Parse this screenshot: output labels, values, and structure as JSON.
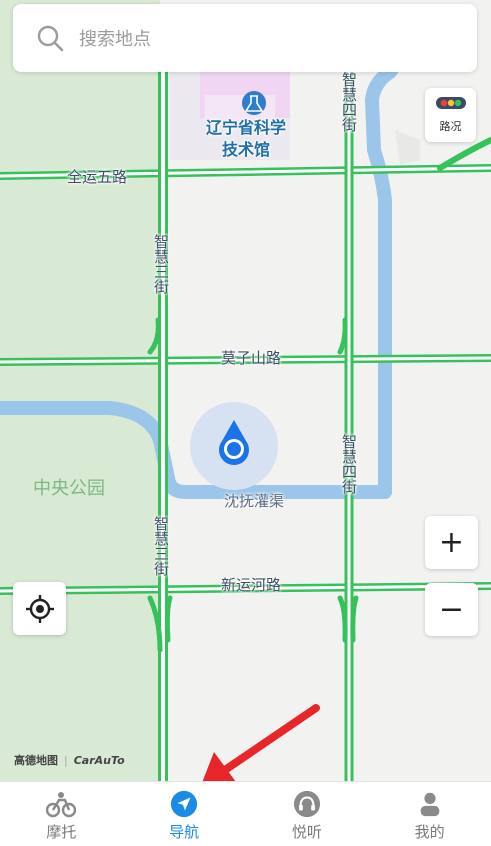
{
  "search": {
    "placeholder": "搜索地点"
  },
  "traffic_button": {
    "label": "路况"
  },
  "zoom": {
    "in_label": "+",
    "out_label": "−"
  },
  "map": {
    "poi": {
      "line1": "辽宁省科学",
      "line2": "技术馆"
    },
    "roads": {
      "quanyun5": "全运五路",
      "mozishan": "莫子山路",
      "xinyunhe": "新运河路",
      "zhihui3_upper": "智慧三街",
      "zhihui3_lower": "智慧三街",
      "zhihui4_upper": "智慧四街",
      "zhihui4_lower": "智慧四街"
    },
    "park": "中央公园",
    "canal": "沈抚灌渠",
    "brand": {
      "amap": "高德地图",
      "separator": "|",
      "carauto": "CarAuTo"
    }
  },
  "tabs": [
    {
      "label": "摩托",
      "icon": "motorcycle-icon",
      "active": false
    },
    {
      "label": "导航",
      "icon": "navigation-icon",
      "active": true
    },
    {
      "label": "悦听",
      "icon": "headphones-icon",
      "active": false
    },
    {
      "label": "我的",
      "icon": "profile-icon",
      "active": false
    }
  ],
  "colors": {
    "road_green": "#35c25a",
    "park_green": "#d8ead4",
    "water": "#9cc5ea",
    "active_tab": "#1a8ce6",
    "annotation_arrow": "#e8262a"
  }
}
